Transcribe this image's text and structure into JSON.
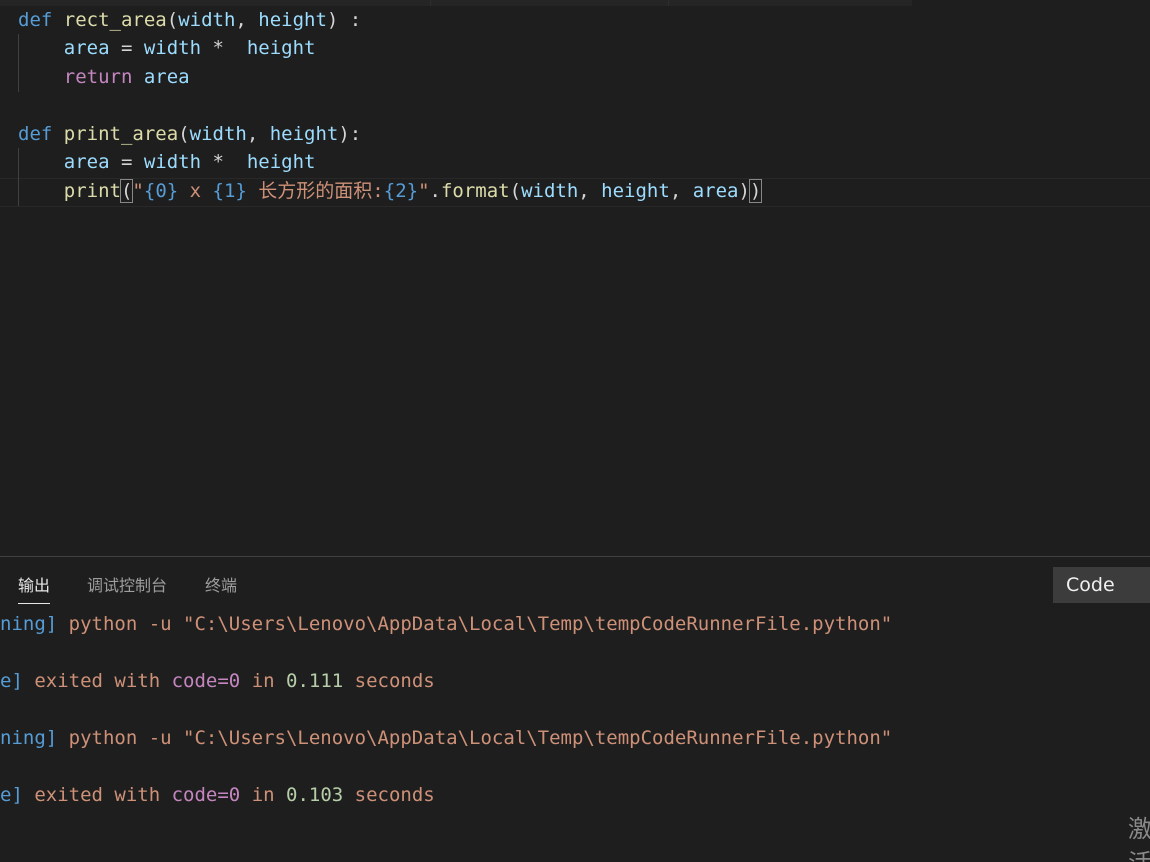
{
  "editor": {
    "lines": [
      {
        "def": "def",
        "name": "rect_area",
        "p1": "width",
        "p2": "height",
        "tail": ") :"
      },
      {
        "var": "area",
        "eq": " = ",
        "a": "width",
        "op": " *  ",
        "b": "height"
      },
      {
        "ret": "return",
        "val": "area"
      },
      {
        "def": "def",
        "name": "print_area",
        "p1": "width",
        "p2": "height",
        "tail": "):"
      },
      {
        "var": "area",
        "eq": " = ",
        "a": "width",
        "op": " *  ",
        "b": "height"
      },
      {
        "fn": "print",
        "q1": "\"",
        "f0": "{0}",
        "s1": " x ",
        "f1": "{1}",
        "s2": " 长方形的面积:",
        "f2": "{2}",
        "q2": "\"",
        "dot": ".",
        "method": "format",
        "a1": "width",
        "a2": "height",
        "a3": "area"
      }
    ]
  },
  "panel": {
    "tabs": [
      "输出",
      "调试控制台",
      "终端"
    ],
    "active_tab": "输出",
    "dropdown_value": "Code",
    "output": [
      {
        "tag": "ning]",
        "cmd": " python -u \"C:\\Users\\Lenovo\\AppData\\Local\\Temp\\tempCodeRunnerFile.python\""
      },
      {
        "tag": "e]",
        "pre": " exited with ",
        "kw": "code=0",
        "mid": " in ",
        "num": "0.111",
        "post": " seconds"
      },
      {
        "tag": "ning]",
        "cmd": " python -u \"C:\\Users\\Lenovo\\AppData\\Local\\Temp\\tempCodeRunnerFile.python\""
      },
      {
        "tag": "e]",
        "pre": " exited with ",
        "kw": "code=0",
        "mid": " in ",
        "num": "0.103",
        "post": " seconds"
      }
    ],
    "watermark": "激活"
  },
  "colors": {
    "background": "#1e1e1e",
    "keyword": "#569cd6",
    "control": "#c586c0",
    "function": "#dcdcaa",
    "variable": "#9cdcfe",
    "string": "#ce9178",
    "number": "#b5cea8"
  }
}
